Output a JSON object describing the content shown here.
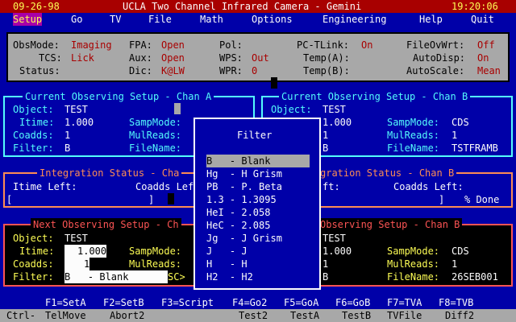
{
  "title": {
    "date": "09-26-98",
    "app": "UCLA Two Channel Infrared Camera - Gemini",
    "time": "19:20:06"
  },
  "menu": [
    "Setup",
    "Go",
    "TV",
    "File",
    "Math",
    "Options",
    "Engineering",
    "Help",
    "Quit"
  ],
  "status": {
    "obsmode_k": "ObsMode:",
    "obsmode_v": "Imaging",
    "tcs_k": "TCS:",
    "tcs_v": "Lick",
    "status_k": "Status:",
    "status_v": "",
    "fpa_k": "FPA:",
    "fpa_v": "Open",
    "aux_k": "Aux:",
    "aux_v": "Open",
    "dic_k": "Dic:",
    "dic_v": "K@LW",
    "pol_k": "Pol:",
    "pol_v": "",
    "wps_k": "WPS:",
    "wps_v": "Out",
    "wpr_k": "WPR:",
    "wpr_v": "0",
    "pctlink_k": "PC-TLink:",
    "pctlink_v": "On",
    "tempa_k": "Temp(A):",
    "tempa_v": "",
    "tempb_k": "Temp(B):",
    "tempb_v": "",
    "fileov_k": "FileOvWrt:",
    "fileov_v": "Off",
    "autodisp_k": "AutoDisp:",
    "autodisp_v": "On",
    "autoscale_k": "AutoScale:",
    "autoscale_v": "Mean"
  },
  "chanA": {
    "title": "Current Observing Setup - Chan A",
    "object_k": "Object:",
    "object_v": "TEST",
    "itime_k": "Itime:",
    "itime_v": "1.000",
    "coadds_k": "Coadds:",
    "coadds_v": "1",
    "filter_k": "Filter:",
    "filter_v": "B",
    "sampmode_k": "SampMode:",
    "mulreads_k": "MulReads:",
    "filename_k": "FileName:"
  },
  "chanB": {
    "title": "Current Observing Setup - Chan B",
    "object_k": "Object:",
    "object_v": "TEST",
    "itime_v": "1.000",
    "coadds_v": "1",
    "filter_v": "B",
    "sampmode_k": "SampMode:",
    "sampmode_v": "CDS",
    "mulreads_k": "MulReads:",
    "mulreads_v": "1",
    "filename_k": "FileName:",
    "filename_v": "TSTFRAMB"
  },
  "integA": {
    "title": "Integration Status - Cha",
    "itime_k": "Itime Left:",
    "coadds_k": "Coadds Lef",
    "lbr": "[",
    "rbr": "]"
  },
  "integB": {
    "title": "gration Status - Chan B",
    "left_k": "ft:",
    "coadds_k": "Coadds Left:",
    "rbr": "]",
    "done": "% Done"
  },
  "nextA": {
    "title": "Next Observing Setup - Ch",
    "object_k": "Object:",
    "object_v": "TEST",
    "itime_k": "Itime:",
    "itime_v": "1.000",
    "coadds_k": "Coadds:",
    "coadds_v": "1",
    "filter_k": "Filter:",
    "filter_v": "B   - Blank",
    "sampmode_k": "SampMode:",
    "mulreads_k": "MulReads:",
    "sc": "SC>"
  },
  "nextB": {
    "title": "Observing Setup - Chan B",
    "object_v": "TEST",
    "itime_v": "1.000",
    "coadds_v": "1",
    "filter_v": "B",
    "sampmode_k": "SampMode:",
    "sampmode_v": "CDS",
    "mulreads_k": "MulReads:",
    "mulreads_v": "1",
    "filename_k": "FileName:",
    "filename_v": "26SEB001"
  },
  "filter_dialog": {
    "title": "Filter",
    "options": [
      "B   - Blank",
      "Hg  - H Grism",
      "PB  - P. Beta",
      "1.3 - 1.3095",
      "HeI - 2.058",
      "HeC - 2.085",
      "Jg  - J Grism",
      "J   - J",
      "H   - H",
      "H2  - H2"
    ],
    "selected_index": 0
  },
  "fkeys": {
    "f1": "F1=SetA",
    "f2": "F2=SetB",
    "f3": "F3=Script",
    "f4": "F4=Go2",
    "f5": "F5=GoA",
    "f6": "F6=GoB",
    "f7": "F7=TVA",
    "f8": "F8=TVB"
  },
  "ctrlkeys": {
    "ctrl": "Ctrl-",
    "telmove": "TelMove",
    "abort2": "Abort2",
    "test2": "Test2",
    "testa": "TestA",
    "testb": "TestB",
    "tvfile": "TVFile",
    "diff2": "Diff2"
  },
  "colors": {
    "titlebar": "#a80000",
    "background": "#0000a8",
    "selection": "#a800a8",
    "panel": "#a8a8a8"
  }
}
